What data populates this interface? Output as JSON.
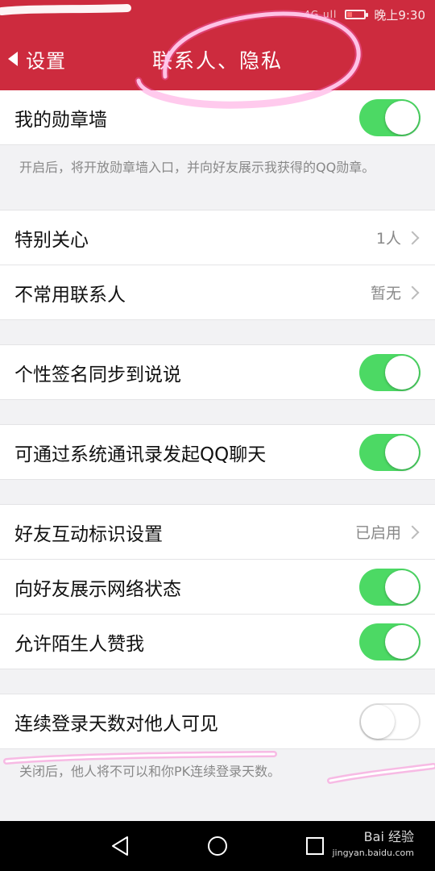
{
  "status_bar": {
    "signal": "4G ull",
    "time": "晚上9:30"
  },
  "header": {
    "back_label": "设置",
    "title": "联系人、隐私"
  },
  "settings": {
    "medal_wall": {
      "label": "我的勋章墙",
      "enabled": true
    },
    "medal_wall_note": "开启后，将开放勋章墙入口，并向好友展示我获得的QQ勋章。",
    "special_care": {
      "label": "特别关心",
      "value": "1人"
    },
    "infrequent_contacts": {
      "label": "不常用联系人",
      "value": "暂无"
    },
    "signature_sync": {
      "label": "个性签名同步到说说",
      "enabled": true
    },
    "system_contacts_chat": {
      "label": "可通过系统通讯录发起QQ聊天",
      "enabled": true
    },
    "interaction_marks": {
      "label": "好友互动标识设置",
      "value": "已启用"
    },
    "network_status": {
      "label": "向好友展示网络状态",
      "enabled": true
    },
    "stranger_likes": {
      "label": "允许陌生人赞我",
      "enabled": true
    },
    "login_days_visible": {
      "label": "连续登录天数对他人可见",
      "enabled": false
    },
    "login_days_note": "关闭后，他人将不可以和你PK连续登录天数。"
  },
  "navbar": {
    "watermark": "Bai 经验",
    "watermark_sub": "jingyan.baidu.com"
  },
  "colors": {
    "header_bg": "#cd2b3e",
    "toggle_on": "#4cd964",
    "annotation": "#ff66cc"
  }
}
